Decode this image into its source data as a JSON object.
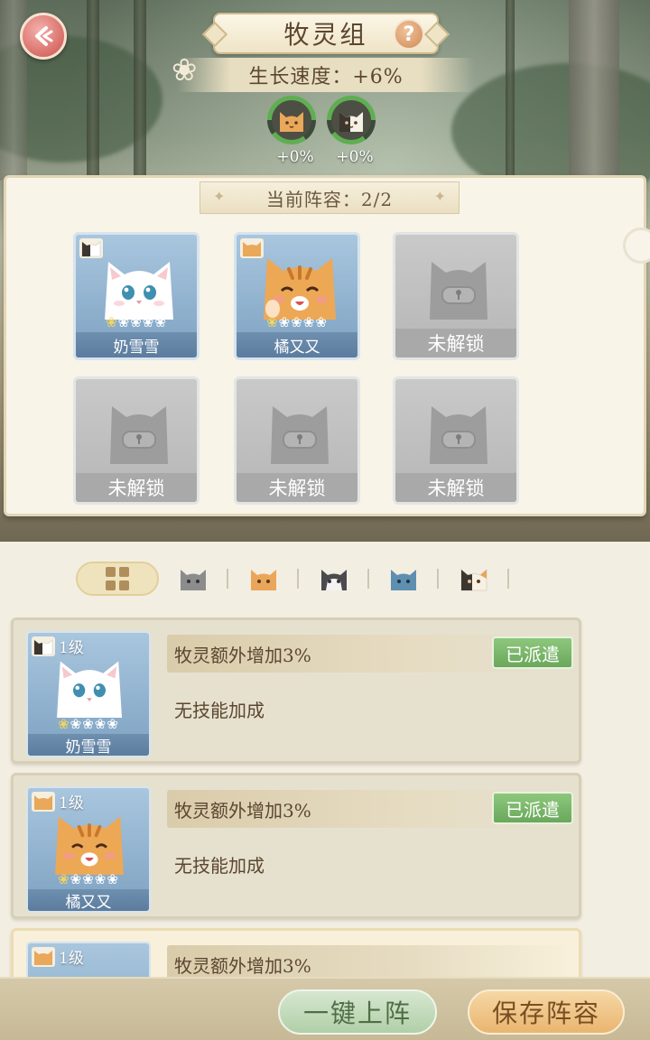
{
  "header": {
    "title": "牧灵组",
    "help_icon_text": "?",
    "growth_speed": "生长速度：+6%",
    "type_bonuses": [
      {
        "icon": "orange-cat-face-icon",
        "value": "+0%",
        "progress": 1.0
      },
      {
        "icon": "calico-cat-face-icon",
        "value": "+0%",
        "progress": 1.0
      }
    ]
  },
  "lineup": {
    "title": "当前阵容：2/2",
    "slots": [
      {
        "name": "奶雪雪",
        "stars_filled": 1,
        "stars_total": 5,
        "locked": false
      },
      {
        "name": "橘又又",
        "stars_filled": 1,
        "stars_total": 5,
        "locked": false
      },
      {
        "name": "未解锁",
        "locked": true
      },
      {
        "name": "未解锁",
        "locked": true
      },
      {
        "name": "未解锁",
        "locked": true
      },
      {
        "name": "未解锁",
        "locked": true
      }
    ]
  },
  "filters": {
    "tabs": [
      "all-grid-icon",
      "gray-cat-icon",
      "orange-cat-icon",
      "tuxedo-cat-icon",
      "blue-cat-icon",
      "calico-cat-icon"
    ],
    "selected": 0
  },
  "cards": [
    {
      "level": "1级",
      "name": "奶雪雪",
      "skill": "牧灵额外增加3%",
      "status": "已派遣",
      "bonus": "无技能加成",
      "stars_filled": 1
    },
    {
      "level": "1级",
      "name": "橘又又",
      "skill": "牧灵额外增加3%",
      "status": "已派遣",
      "bonus": "无技能加成",
      "stars_filled": 1
    },
    {
      "level": "1级",
      "name": "",
      "skill": "牧灵额外增加3%",
      "status": "",
      "bonus": "",
      "stars_filled": 0
    }
  ],
  "actions": {
    "auto_deploy": "一键上阵",
    "save_lineup": "保存阵容"
  },
  "colors": {
    "accent_green": "#6aa85b",
    "accent_orange": "#e9b570",
    "back_button": "#d86d68",
    "panel_bg": "#f8f4e8"
  }
}
